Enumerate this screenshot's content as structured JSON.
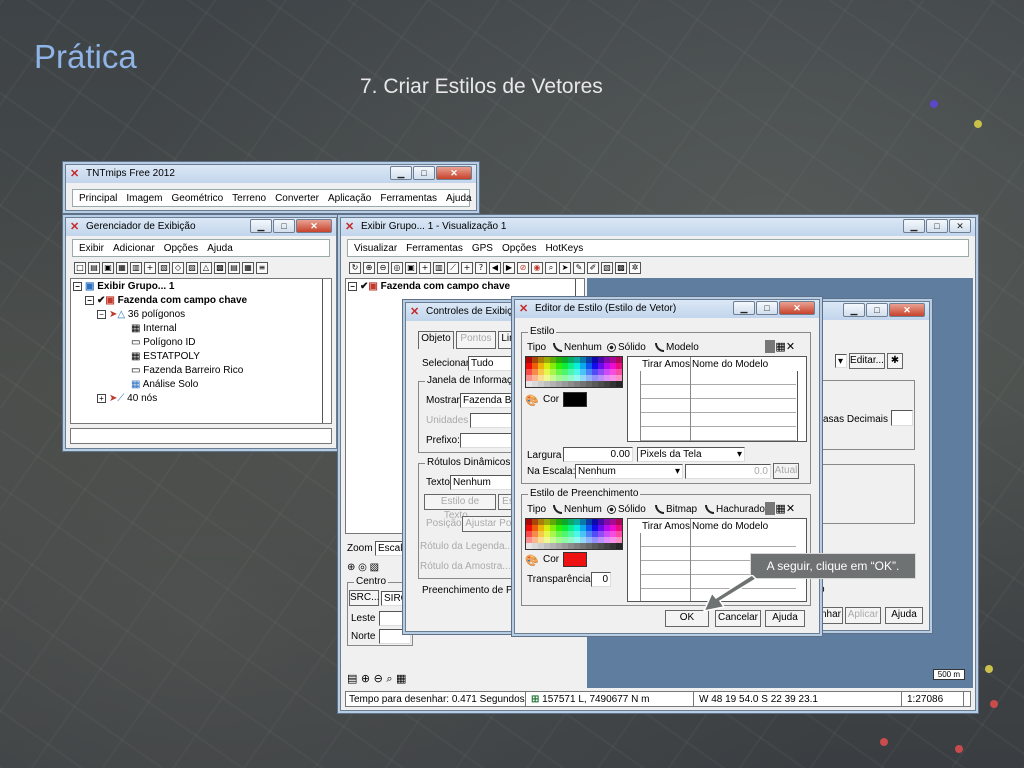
{
  "slide": {
    "title": "Prática",
    "subtitle": "7. Criar Estilos de Vetores"
  },
  "tnt_window": {
    "title": "TNTmips Free 2012",
    "menu": [
      "Principal",
      "Imagem",
      "Geométrico",
      "Terreno",
      "Converter",
      "Aplicação",
      "Ferramentas",
      "Ajuda"
    ]
  },
  "display_manager": {
    "title": "Gerenciador de Exibição",
    "menu": [
      "Exibir",
      "Adicionar",
      "Opções",
      "Ajuda"
    ],
    "tree": {
      "group": "Exibir Grupo... 1",
      "layer": "Fazenda com campo chave",
      "polygons": "36 polígonos",
      "tables": [
        "Internal",
        "Polígono ID",
        "ESTATPOLY",
        "Fazenda Barreiro Rico",
        "Análise Solo"
      ],
      "nodes": "40 nós"
    }
  },
  "view_window": {
    "title": "Exibir Grupo... 1 - Visualização 1",
    "menu": [
      "Visualizar",
      "Ferramentas",
      "GPS",
      "Opções",
      "HotKeys"
    ],
    "layer": "Fazenda com campo chave",
    "zoom_label": "Zoom",
    "zoom_value": "Escala",
    "centro_label": "Centro",
    "src_label": "SRC...",
    "src_value": "SIRG",
    "leste_label": "Leste",
    "norte_label": "Norte",
    "scale_bar": "500 m",
    "status": {
      "draw_time": "Tempo para desenhar: 0.471 Segundos",
      "coords_lm": "157571 L, 7490677 N m",
      "coords_geo": "W 48 19 54.0  S 22 39 23.1",
      "scale": "1:27086"
    }
  },
  "controls": {
    "title": "Controles de Exibição",
    "tabs": [
      "Objeto",
      "Pontos",
      "Lin"
    ],
    "selecionar_label": "Selecionar",
    "selecionar_value": "Tudo",
    "info_group": "Janela de Informaç",
    "mostrar_label": "Mostrar",
    "mostrar_value": "Fazenda Bar",
    "unidades_label": "Unidades",
    "prefixo_label": "Prefixo:",
    "rotulos_group": "Rótulos Dinâmicos",
    "texto_label": "Texto",
    "texto_value": "Nenhum",
    "estilo_texto_btn": "Estilo de Texto...",
    "estilo_texto_extra": "Es",
    "posicao_label": "Posição",
    "ajustar_btn": "Ajustar Por",
    "rotulo_legenda": "Rótulo da Legenda...",
    "rotulo_amostra": "Rótulo da Amostra...",
    "preenchimento_label": "Preenchimento de Po"
  },
  "back_dialog": {
    "editar_btn": "Editar...",
    "casas_label": "asas Decimais",
    "nhar_btn": "nhar",
    "aplicar_btn": "Aplicar",
    "ajuda_btn": "Ajuda",
    "p_fragment": "p"
  },
  "style_editor": {
    "title": "Editor de Estilo (Estilo de Vetor)",
    "estilo_group": "Estilo",
    "tipo_label": "Tipo",
    "tipo_options": [
      "Nenhum",
      "Sólido",
      "Modelo"
    ],
    "col_tirar": "Tirar Amos",
    "col_nome": "Nome do Modelo",
    "cor_label": "Cor",
    "line_color": "#000000",
    "largura_label": "Largura",
    "largura_value": "0.00",
    "pixels_value": "Pixels da Tela",
    "na_escala_label": "Na Escala:",
    "na_escala_value": "Nenhum",
    "escala_num": "0.0",
    "atual_btn": "Atual",
    "fill_group": "Estilo de Preenchimento",
    "fill_tipo_options": [
      "Nenhum",
      "Sólido",
      "Bitmap",
      "Hachurado"
    ],
    "fill_color": "#ee1111",
    "transparencia_label": "Transparência",
    "transparencia_value": "0",
    "ok_btn": "OK",
    "cancelar_btn": "Cancelar",
    "ajuda_btn": "Ajuda"
  },
  "tooltip": {
    "text": "A seguir, clique em “OK”."
  }
}
